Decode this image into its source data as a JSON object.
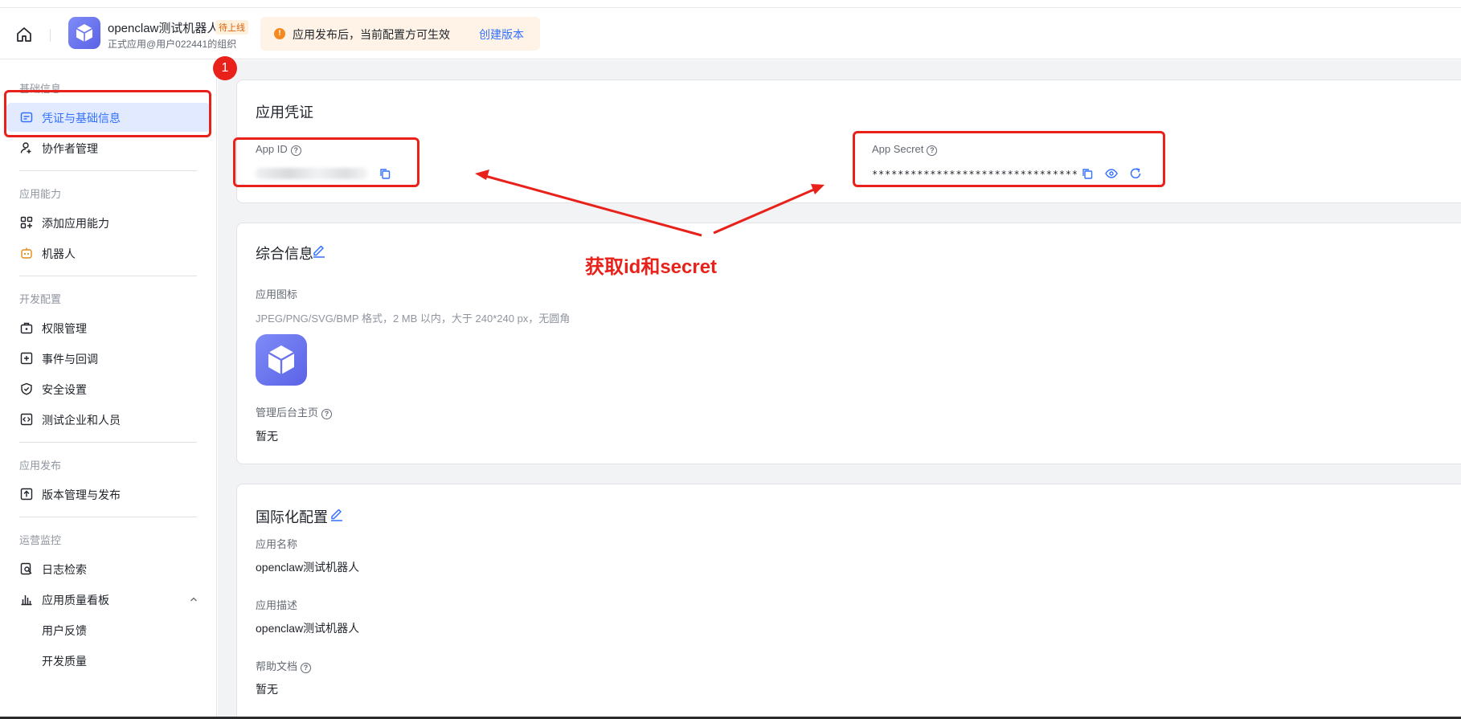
{
  "header": {
    "app_name": "openclaw测试机器人",
    "status_badge": "待上线",
    "org_text": "正式应用@用户022441的组织",
    "notice_text": "应用发布后，当前配置方可生效",
    "notice_link": "创建版本"
  },
  "sidebar": {
    "groups": {
      "basic": "基础信息",
      "capability": "应用能力",
      "dev": "开发配置",
      "release": "应用发布",
      "ops": "运营监控"
    },
    "items": {
      "credentials": "凭证与基础信息",
      "collaborators": "协作者管理",
      "add_capability": "添加应用能力",
      "bot": "机器人",
      "permissions": "权限管理",
      "events": "事件与回调",
      "security": "安全设置",
      "test_org": "测试企业和人员",
      "versions": "版本管理与发布",
      "logs": "日志检索",
      "quality_board": "应用质量看板",
      "feedback": "用户反馈",
      "dev_quality": "开发质量"
    }
  },
  "credentials_card": {
    "title": "应用凭证",
    "app_id_label": "App ID",
    "app_secret_label": "App Secret",
    "app_secret_masked": "********************************"
  },
  "general_card": {
    "title": "综合信息",
    "icon_label": "应用图标",
    "icon_hint": "JPEG/PNG/SVG/BMP 格式，2 MB 以内，大于 240*240 px，无圆角",
    "homepage_label": "管理后台主页",
    "homepage_value": "暂无"
  },
  "i18n_card": {
    "title": "国际化配置",
    "name_label": "应用名称",
    "name_value": "openclaw测试机器人",
    "desc_label": "应用描述",
    "desc_value": "openclaw测试机器人",
    "help_label": "帮助文档",
    "help_value": "暂无"
  },
  "annotations": {
    "step_number": "1",
    "callout_text": "获取id和secret",
    "color": "#e8221b"
  },
  "colors": {
    "brand_blue": "#3370ff",
    "active_bg": "#e1eaff",
    "notice_bg": "#fef3e6",
    "badge_orange": "#d9640f"
  }
}
